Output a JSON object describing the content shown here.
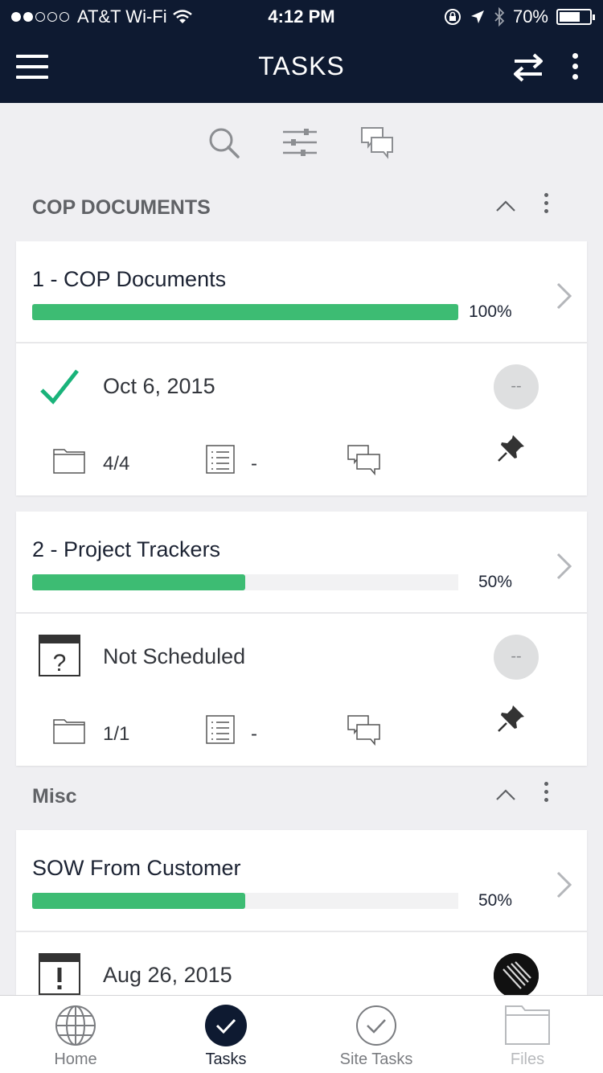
{
  "status_bar": {
    "carrier": "AT&T Wi-Fi",
    "time": "4:12 PM",
    "battery": "70%",
    "battery_level": 0.7
  },
  "header": {
    "title": "TASKS"
  },
  "sections": [
    {
      "title": "COP DOCUMENTS",
      "cards": [
        {
          "title": "1 - COP Documents",
          "progress": 100,
          "progress_label": "100%",
          "status_icon": "checkmark-icon",
          "date": "Oct 6, 2015",
          "assignee": "--",
          "files": "4/4",
          "checklist": "-"
        },
        {
          "title": "2 - Project Trackers",
          "progress": 50,
          "progress_label": "50%",
          "status_icon": "calendar-question-icon",
          "date": "Not Scheduled",
          "assignee": "--",
          "files": "1/1",
          "checklist": "-"
        }
      ]
    },
    {
      "title": "Misc",
      "cards": [
        {
          "title": "SOW From Customer",
          "progress": 50,
          "progress_label": "50%",
          "status_icon": "calendar-alert-icon",
          "date": "Aug 26, 2015",
          "assignee_avatar": "avatar"
        }
      ]
    }
  ],
  "tabs": [
    {
      "label": "Home",
      "icon": "globe-icon"
    },
    {
      "label": "Tasks",
      "icon": "check-circle-icon",
      "active": true
    },
    {
      "label": "Site Tasks",
      "icon": "check-circle-outline-icon"
    },
    {
      "label": "Files",
      "icon": "folder-icon",
      "disabled": true
    }
  ],
  "colors": {
    "header_bg": "#0e1a31",
    "progress_fill": "#3dbc73",
    "check_green": "#19b37a"
  }
}
